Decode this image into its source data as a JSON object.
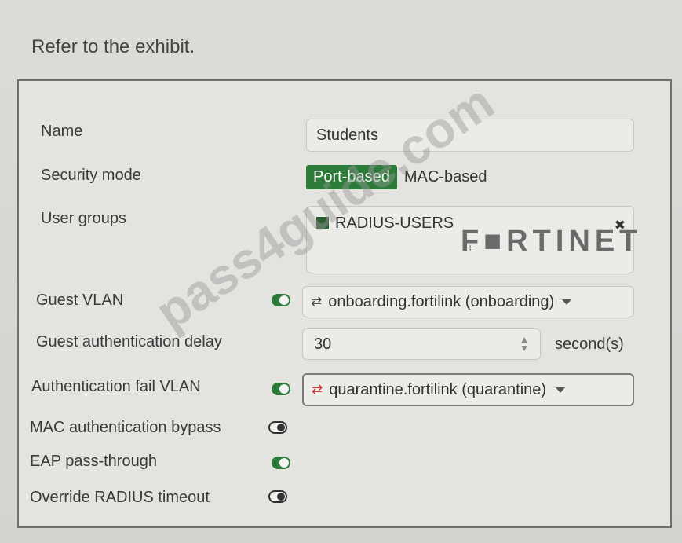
{
  "exhibit_title": "Refer to the exhibit.",
  "watermark": "pass4guide.com",
  "logo": "F■RTINET",
  "form": {
    "name_label": "Name",
    "name_value": "Students",
    "security_mode_label": "Security mode",
    "security_mode_options": [
      "Port-based",
      "MAC-based"
    ],
    "security_mode_selected": "Port-based",
    "user_groups_label": "User groups",
    "user_group_value": "RADIUS-USERS",
    "user_group_remove": "✖",
    "user_group_add": "+",
    "guest_vlan_label": "Guest VLAN",
    "guest_vlan_enabled": true,
    "guest_vlan_value": "onboarding.fortilink (onboarding)",
    "guest_auth_delay_label": "Guest authentication delay",
    "guest_auth_delay_value": "30",
    "guest_auth_delay_unit": "second(s)",
    "auth_fail_vlan_label": "Authentication fail VLAN",
    "auth_fail_vlan_enabled": true,
    "auth_fail_vlan_value": "quarantine.fortilink (quarantine)",
    "mac_auth_bypass_label": "MAC authentication bypass",
    "mac_auth_bypass_enabled": false,
    "eap_passthrough_label": "EAP pass-through",
    "eap_passthrough_enabled": true,
    "override_radius_timeout_label": "Override RADIUS timeout",
    "override_radius_timeout_enabled": false
  },
  "colors": {
    "accent_green": "#2d7b39",
    "quarantine_red": "#d62a2a"
  }
}
